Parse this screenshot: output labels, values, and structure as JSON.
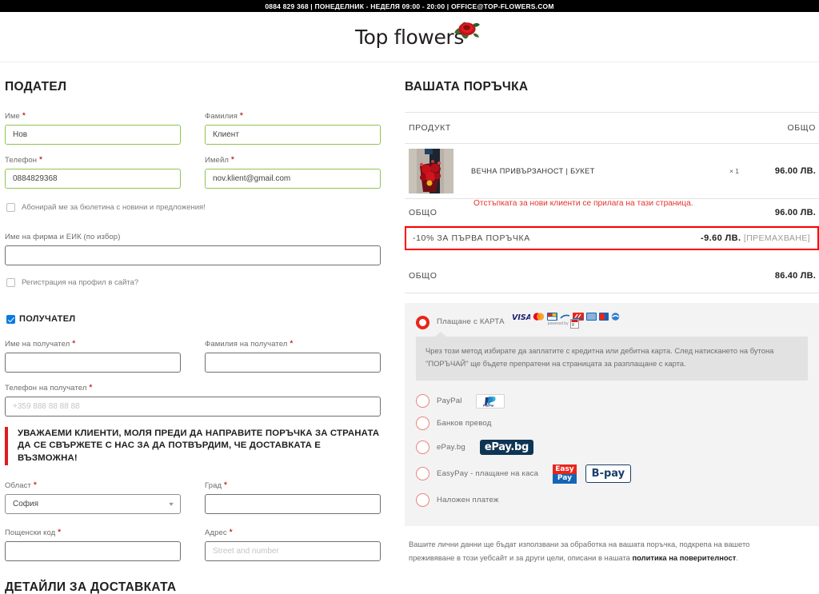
{
  "topbar": {
    "contact_line": "0884 829 368 | ПОНЕДЕЛНИК - НЕДЕЛЯ 09:00 - 20:00 | OFFICE@TOP-FLOWERS.COM"
  },
  "brand": {
    "logo_text": "Top flowers"
  },
  "billing": {
    "title": "ПОДАТЕЛ",
    "first_name": {
      "label": "Име",
      "required": true,
      "value": "Нов"
    },
    "last_name": {
      "label": "Фамилия",
      "required": true,
      "value": "Клиент"
    },
    "phone": {
      "label": "Телефон",
      "required": true,
      "value": "0884829368"
    },
    "email": {
      "label": "Имейл",
      "required": true,
      "value": "nov.klient@gmail.com"
    },
    "newsletter": {
      "label": "Абонирай ме за бюлетина с новини и предложения!",
      "checked": false
    },
    "company": {
      "label": "Име на фирма и ЕИК (по избор)",
      "value": ""
    },
    "create_account": {
      "label": "Регистрация на профил в сайта?",
      "checked": false
    }
  },
  "recipient": {
    "toggle_label": "ПОЛУЧАТЕЛ",
    "toggle_checked": true,
    "first_name": {
      "label": "Име на получател",
      "required": true,
      "value": ""
    },
    "last_name": {
      "label": "Фамилия на получател",
      "required": true,
      "value": ""
    },
    "phone": {
      "label": "Телефон на получател",
      "required": true,
      "value": "",
      "placeholder": "+359 888 88 88 88"
    },
    "notice": "УВАЖАЕМИ КЛИЕНТИ, МОЛЯ ПРЕДИ ДА НАПРАВИТЕ ПОРЪЧКА ЗА СТРАНАТА ДА СЕ СВЪРЖЕТЕ С НАС ЗА ДА ПОТВЪРДИМ, ЧЕ ДОСТАВКАТА Е ВЪЗМОЖНА!",
    "region": {
      "label": "Област",
      "required": true,
      "value": "София"
    },
    "city": {
      "label": "Град",
      "required": true,
      "value": ""
    },
    "postcode": {
      "label": "Пощенски код",
      "required": true,
      "value": ""
    },
    "address": {
      "label": "Адрес",
      "required": true,
      "value": "",
      "placeholder": "Street and number"
    },
    "delivery_title": "ДЕТАЙЛИ ЗА ДОСТАВКАТА"
  },
  "order": {
    "title": "ВАШАТА ПОРЪЧКА",
    "col_product": "ПРОДУКТ",
    "col_total": "ОБЩО",
    "items": [
      {
        "name": "ВЕЧНА ПРИВЪРЗАНОСТ | БУКЕТ",
        "qty": "× 1",
        "total": "96.00 ЛВ."
      }
    ],
    "subtotal_label": "ОБЩО",
    "subtotal_value": "96.00 ЛВ.",
    "discount_message": "Отстъпката за нови клиенти се прилага на тази страница.",
    "coupon_label": "-10% ЗА ПЪРВА ПОРЪЧКА",
    "coupon_value": "-9.60 ЛВ.",
    "coupon_remove": "[ПРЕМАХВАНЕ]",
    "total_label": "ОБЩО",
    "total_value": "86.40 ЛВ."
  },
  "payment": {
    "methods": [
      {
        "id": "card",
        "label": "Плащане с КАРТА",
        "selected": true
      },
      {
        "id": "paypal",
        "label": "PayPal",
        "selected": false
      },
      {
        "id": "bank",
        "label": "Банков превод",
        "selected": false
      },
      {
        "id": "epay",
        "label": "ePay.bg",
        "selected": false
      },
      {
        "id": "easypay",
        "label": "EasyPay - плащане на каса",
        "selected": false
      },
      {
        "id": "cod",
        "label": "Наложен платеж",
        "selected": false
      }
    ],
    "powered_by": "powered by",
    "card_description": "Чрез този метод избирате да заплатите с кредитна или дебитна карта. След натискането на бутона \"ПОРЪЧАЙ\" ще бъдете препратени на страницата за разплащане с карта.",
    "epay_logo_text": "ePay.bg",
    "easypay_logo_text_1": "Easy",
    "easypay_logo_text_2": "Pay",
    "bpay_logo_text": "B-pay",
    "paypal_logo_text": "PayPal",
    "privacy_text_1": "Вашите лични данни ще бъдат използвани за обработка на вашата поръчка, подкрепа на вашето преживяване в този уебсайт и за други цели, описани в нашата ",
    "privacy_link": "политика на поверителност",
    "privacy_text_2": "."
  },
  "colors": {
    "accent_red": "#e8261c",
    "valid_green": "#8dc553",
    "coupon_border": "#ff0000",
    "brand_dark": "#231f20"
  }
}
